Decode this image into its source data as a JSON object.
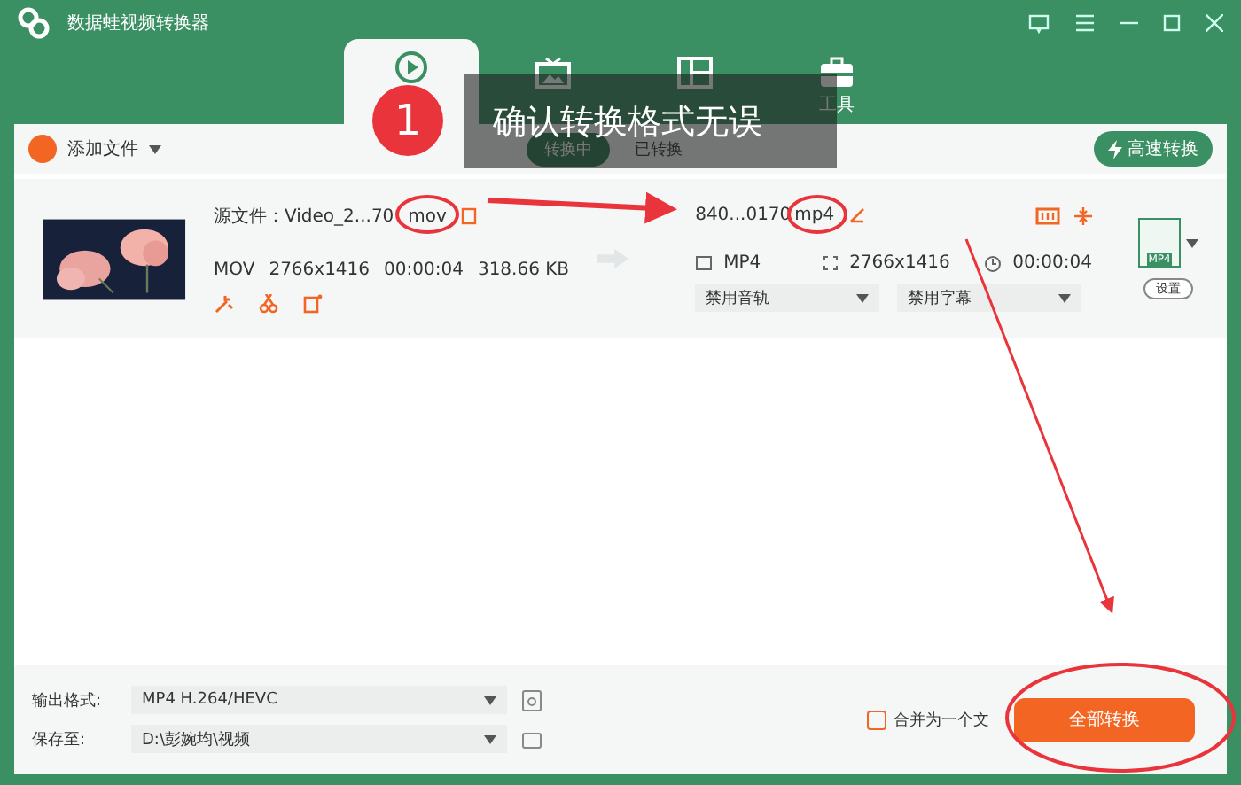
{
  "window": {
    "title": "数据蛙视频转换器"
  },
  "main_tabs": [
    {
      "kind": "convert",
      "selected": true
    },
    {
      "kind": "video",
      "selected": false
    },
    {
      "kind": "split",
      "selected": false
    },
    {
      "kind": "tools",
      "selected": false,
      "label": "工具"
    }
  ],
  "sub_tabs": [
    {
      "label": "转换中",
      "selected": true
    },
    {
      "label": "已转换",
      "selected": false
    }
  ],
  "toolbar": {
    "add_file": "添加文件",
    "fast_convert": "高速转换"
  },
  "file": {
    "source_label": "源文件：",
    "source_name": "Video_2...70",
    "source_ext": "mov",
    "format": "MOV",
    "resolution": "2766x1416",
    "duration": "00:00:04",
    "size": "318.66 KB",
    "output_name": "840...0170",
    "output_ext": "mp4",
    "out_format": "MP4",
    "out_resolution": "2766x1416",
    "out_duration": "00:00:04",
    "audio": "禁用音轨",
    "subtitle": "禁用字幕",
    "format_badge": "MP4",
    "settings": "设置"
  },
  "bottom": {
    "format_label": "输出格式:",
    "format_value": "MP4 H.264/HEVC",
    "save_label": "保存至:",
    "save_value": "D:\\彭婉均\\视频",
    "merge": {
      "label": "合并为一个文",
      "checked": false
    },
    "convert_all": "全部转换"
  },
  "annotation": {
    "number": "1",
    "text": "确认转换格式无误"
  }
}
